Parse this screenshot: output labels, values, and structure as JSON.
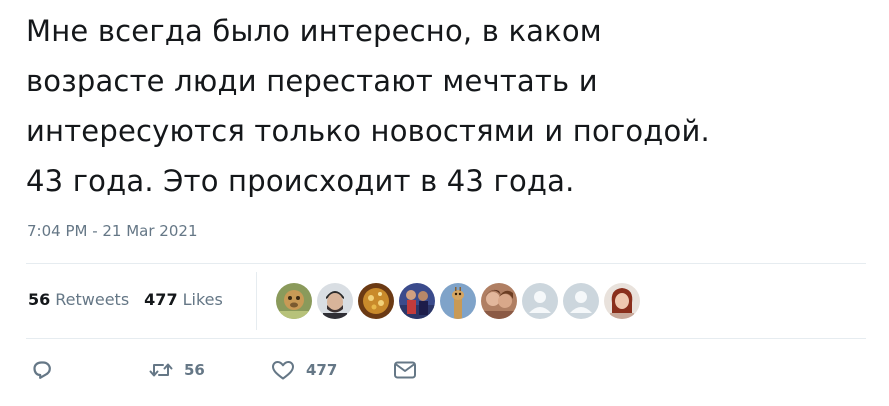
{
  "tweet": {
    "text_lines": [
      "Мне всегда было интересно, в каком",
      "возрасте люди перестают мечтать и",
      "интересуются только новостями и погодой.",
      "43 года. Это происходит в 43 года."
    ],
    "timestamp": "7:04 PM - 21 Mar 2021"
  },
  "stats": {
    "retweets_count": "56",
    "retweets_label": "Retweets",
    "likes_count": "477",
    "likes_label": "Likes"
  },
  "actions": {
    "reply_icon": "reply-icon",
    "retweet_icon": "retweet-icon",
    "retweet_count": "56",
    "like_icon": "heart-icon",
    "like_count": "477",
    "message_icon": "envelope-icon"
  },
  "colors": {
    "text": "#14171a",
    "muted": "#657786",
    "divider": "#e6ecf0",
    "default_avatar": "#ccd6dd"
  }
}
